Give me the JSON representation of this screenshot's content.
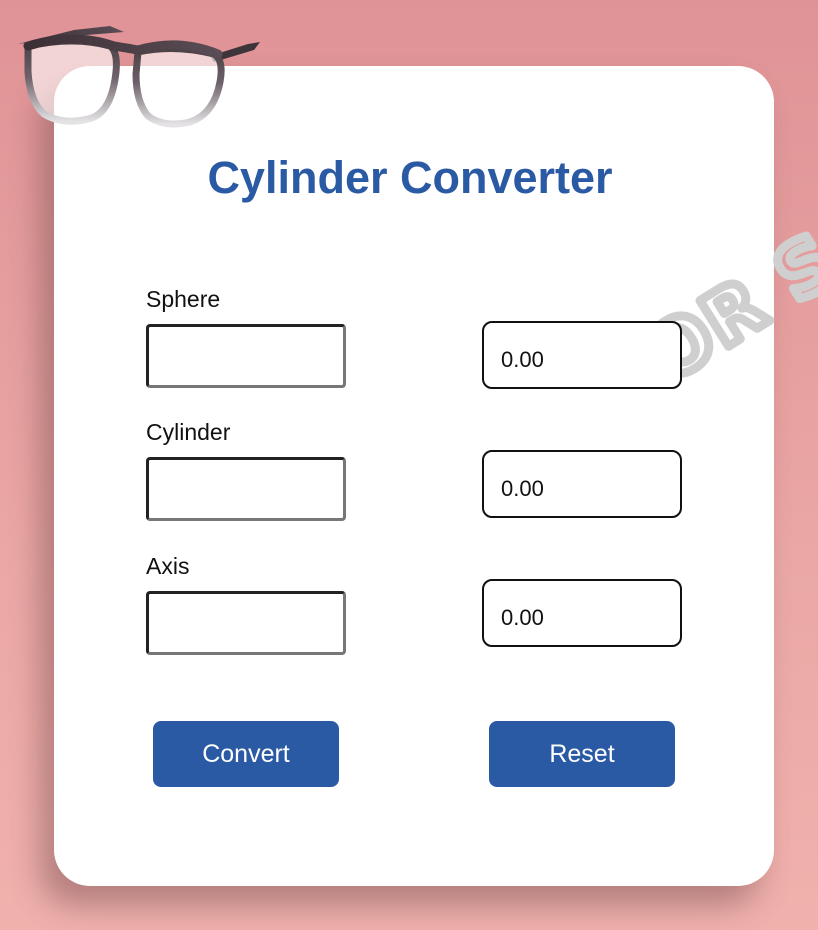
{
  "title": "Cylinder Converter",
  "watermark_text": "FOR SCUM",
  "fields": [
    {
      "label": "Sphere",
      "value": "",
      "result": "0.00"
    },
    {
      "label": "Cylinder",
      "value": "",
      "result": "0.00"
    },
    {
      "label": "Axis",
      "value": "",
      "result": "0.00"
    }
  ],
  "buttons": {
    "convert_label": "Convert",
    "reset_label": "Reset"
  },
  "icons": {
    "decoration": "eyeglasses-icon"
  },
  "colors": {
    "accent": "#2b5aa5",
    "background": "#e09396",
    "card": "#ffffff"
  }
}
